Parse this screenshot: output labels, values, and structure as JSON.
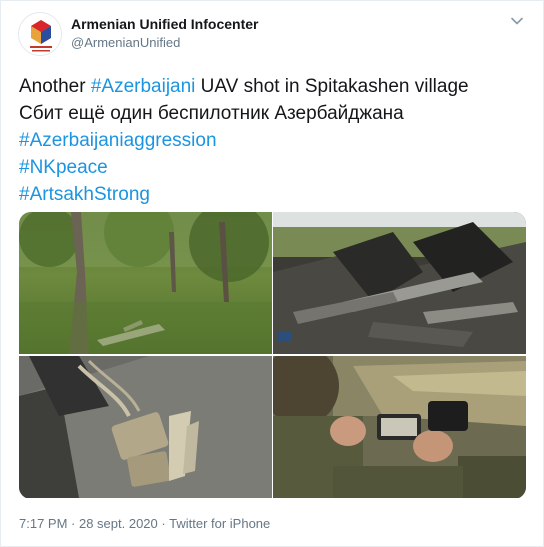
{
  "user": {
    "name": "Armenian Unified Infocenter",
    "handle": "@ArmenianUnified"
  },
  "tweet": {
    "line1_pre": "Another ",
    "line1_hashtag": "#Azerbaijani",
    "line1_post": " UAV shot in Spitakashen village",
    "line2": "Сбит ещё один беспилотник Азербайджана",
    "hashtags": [
      "#Azerbaijaniaggression",
      "#NKpeace",
      "#ArtsakhStrong"
    ]
  },
  "meta": {
    "time": "7:17 PM",
    "separator": " · ",
    "date": "28 sept. 2020",
    "source": "Twitter for iPhone"
  },
  "colors": {
    "link": "#1b95e0",
    "text": "#14171a",
    "secondary": "#657786"
  },
  "icons": {
    "menu": "chevron-down-icon"
  }
}
